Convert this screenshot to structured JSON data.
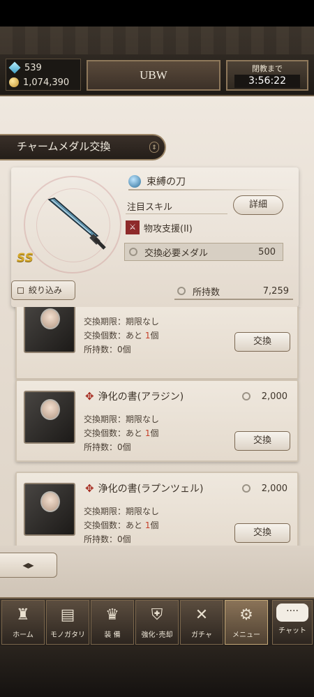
{
  "resources": {
    "gems": "539",
    "gold": "1,074,390"
  },
  "header": {
    "title": "UBW",
    "timer_label": "閉教まで",
    "timer_value": "3:56:22"
  },
  "section_title": "チャームメダル交換",
  "selected_item": {
    "name": "束縛の刀",
    "skill_label": "注目スキル",
    "detail_button": "詳細",
    "skill_name": "物攻支援(II)",
    "rank": "SS",
    "medal_cost_label": "交換必要メダル",
    "medal_cost": "500"
  },
  "filter_button": "絞り込み",
  "owned": {
    "label": "所持数",
    "value": "7,259"
  },
  "items": [
    {
      "title": "",
      "cost": "",
      "line1": "交換期限：期限なし",
      "line2_prefix": "交換個数：あと",
      "line2_count": "1",
      "line2_suffix": "個",
      "line3": "所持数：0個",
      "button": "交換"
    },
    {
      "title": "浄化の書(アラジン)",
      "cost": "2,000",
      "line1": "交換期限：期限なし",
      "line2_prefix": "交換個数：あと",
      "line2_count": "1",
      "line2_suffix": "個",
      "line3": "所持数：0個",
      "button": "交換"
    },
    {
      "title": "浄化の書(ラプンツェル)",
      "cost": "2,000",
      "line1": "交換期限：期限なし",
      "line2_prefix": "交換個数：あと",
      "line2_count": "1",
      "line2_suffix": "個",
      "line3": "所持数：0個",
      "button": "交換"
    }
  ],
  "nav": [
    {
      "label": "ホーム",
      "icon": "castle-icon"
    },
    {
      "label": "モノガタリ",
      "icon": "book-icon"
    },
    {
      "label": "装 備",
      "icon": "equipment-icon"
    },
    {
      "label": "強化･売却",
      "icon": "enhance-icon"
    },
    {
      "label": "ガチャ",
      "icon": "gacha-icon"
    },
    {
      "label": "メニュー",
      "icon": "gear-icon",
      "active": true
    }
  ],
  "chat": {
    "label": "チャット",
    "bubble": "····"
  }
}
